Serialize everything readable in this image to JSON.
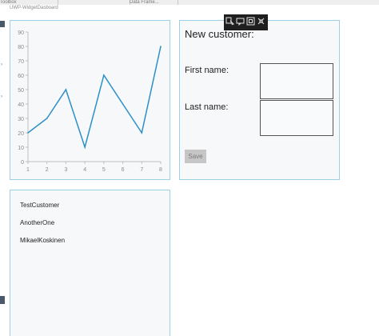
{
  "window": {
    "title": "UWP-WidgetDasboard"
  },
  "background_strip": {
    "segment_1": "Toolbox",
    "segment_2": "Data Frame..."
  },
  "chart_data": {
    "type": "line",
    "x": [
      1,
      2,
      3,
      4,
      5,
      6,
      7,
      8
    ],
    "values": [
      20,
      30,
      50,
      10,
      60,
      40,
      20,
      80
    ],
    "xticks": [
      1,
      2,
      3,
      4,
      5,
      6,
      7,
      8
    ],
    "yticks": [
      0,
      10,
      20,
      30,
      40,
      50,
      60,
      70,
      80,
      90
    ],
    "ylim": [
      0,
      90
    ],
    "xlim": [
      1,
      8
    ],
    "grid": false,
    "title": "",
    "xlabel": "",
    "ylabel": "",
    "series_color": "#2e8fc7"
  },
  "form": {
    "title": "New customer:",
    "first_name_label": "First name:",
    "first_name_value": "",
    "last_name_label": "Last name:",
    "last_name_value": "",
    "save_label": "Save"
  },
  "customers": [
    "TestCustomer",
    "AnotherOne",
    "MikaelKoskinen"
  ],
  "floating_toolbar": {
    "icons": [
      "select-element-icon",
      "layout-adorner-icon",
      "track-focus-icon",
      "display-layout-icon"
    ]
  },
  "colors": {
    "panel_border": "#9cd0e6",
    "panel_bg": "#f6f8fa",
    "save_button_bg": "#c6c6c6"
  }
}
